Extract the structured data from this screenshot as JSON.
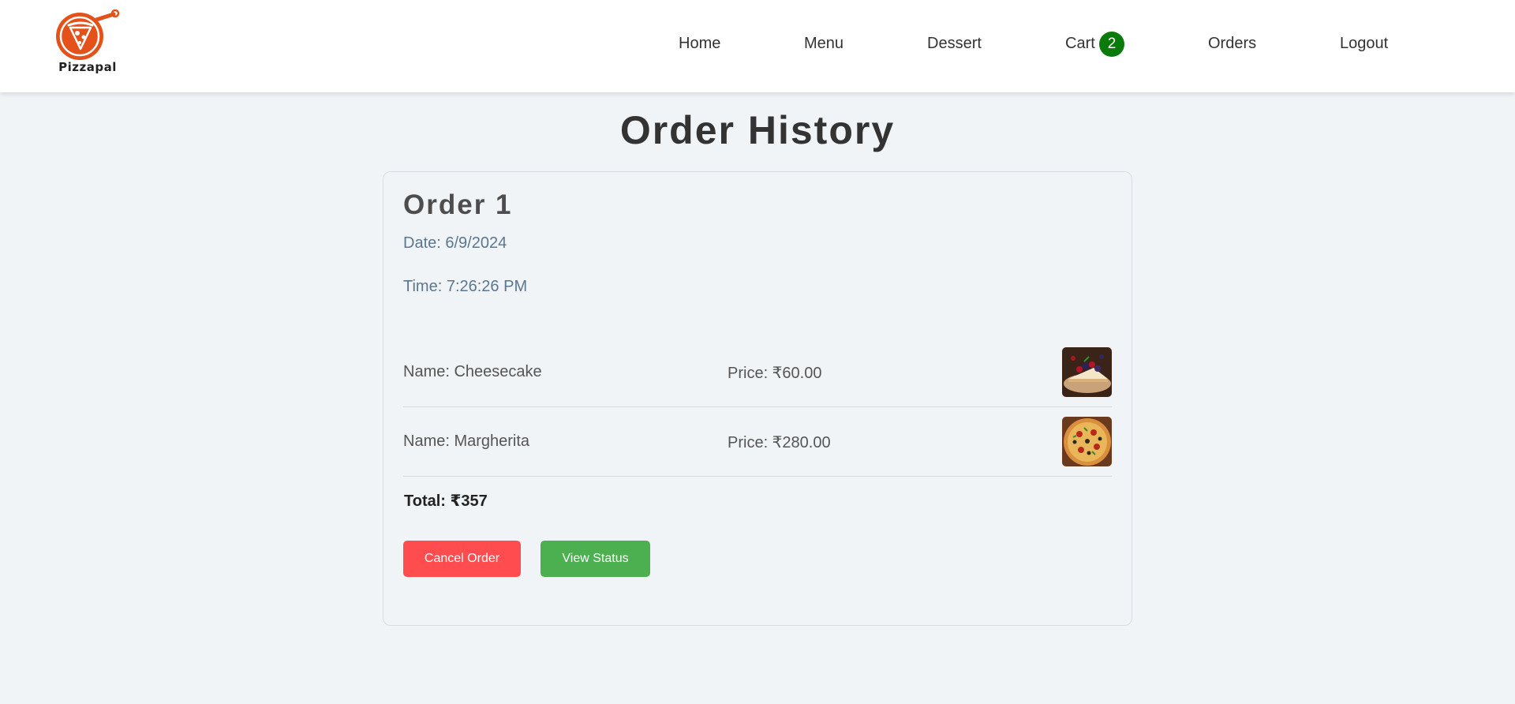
{
  "brand": {
    "name": "Pizzapal",
    "accent": "#e5511a"
  },
  "nav": {
    "home": "Home",
    "menu": "Menu",
    "dessert": "Dessert",
    "cart": "Cart",
    "cart_count": "2",
    "orders": "Orders",
    "logout": "Logout"
  },
  "page": {
    "title": "Order History"
  },
  "order": {
    "title": "Order 1",
    "date": "Date: 6/9/2024",
    "time": "Time: 7:26:26 PM",
    "items": [
      {
        "name": "Name: Cheesecake",
        "price": "Price: ₹60.00",
        "thumb_icon": "cheesecake-image"
      },
      {
        "name": "Name: Margherita",
        "price": "Price: ₹280.00",
        "thumb_icon": "pizza-image"
      }
    ],
    "total": "Total: ₹357",
    "cancel_label": "Cancel Order",
    "status_label": "View Status"
  },
  "colors": {
    "cancel": "#ff4d4f",
    "status": "#4caf50",
    "cart_badge": "#0a7a0a",
    "background": "#f0f4f7"
  }
}
